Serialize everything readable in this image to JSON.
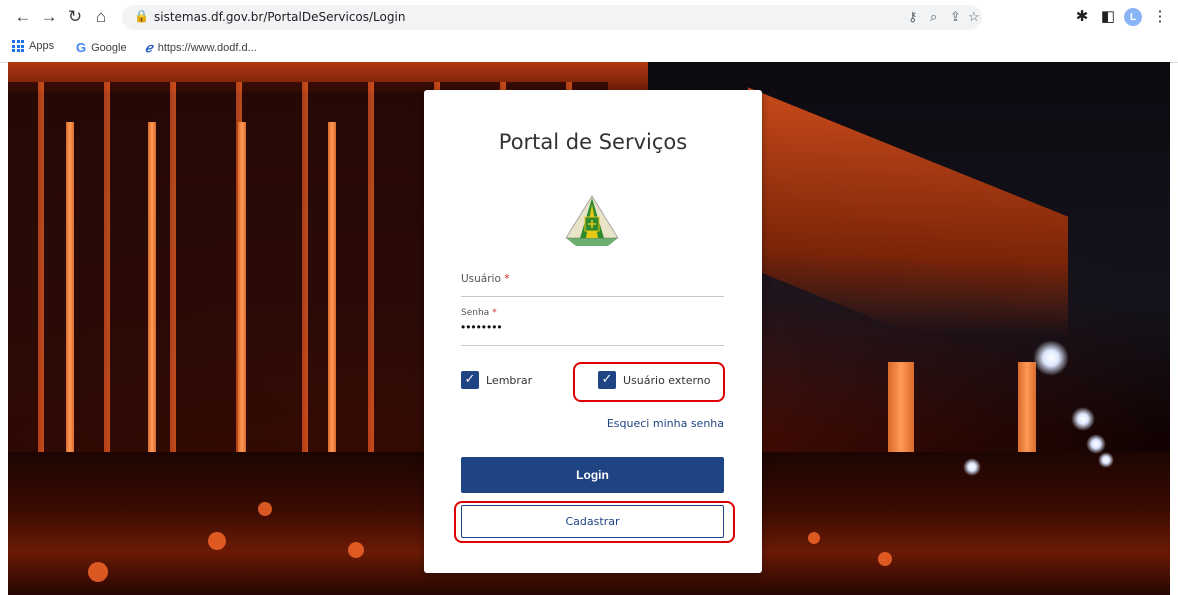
{
  "browser": {
    "url": "sistemas.df.gov.br/PortalDeServicos/Login",
    "avatar_letter": "L",
    "bookmarks": [
      {
        "label": "Apps",
        "icon": "apps-grid-icon"
      },
      {
        "label": "Google",
        "icon": "google-icon"
      },
      {
        "label": "https://www.dodf.d...",
        "icon": "ie-icon"
      }
    ]
  },
  "login": {
    "title": "Portal de Serviços",
    "username_label": "Usuário",
    "password_label": "Senha",
    "required_mark": "*",
    "password_value": "••••••••",
    "remember_label": "Lembrar",
    "external_user_label": "Usuário externo",
    "forgot_link": "Esqueci minha senha",
    "login_button": "Login",
    "register_button": "Cadastrar"
  },
  "colors": {
    "primary": "#1f4483",
    "highlight": "#e00000"
  }
}
